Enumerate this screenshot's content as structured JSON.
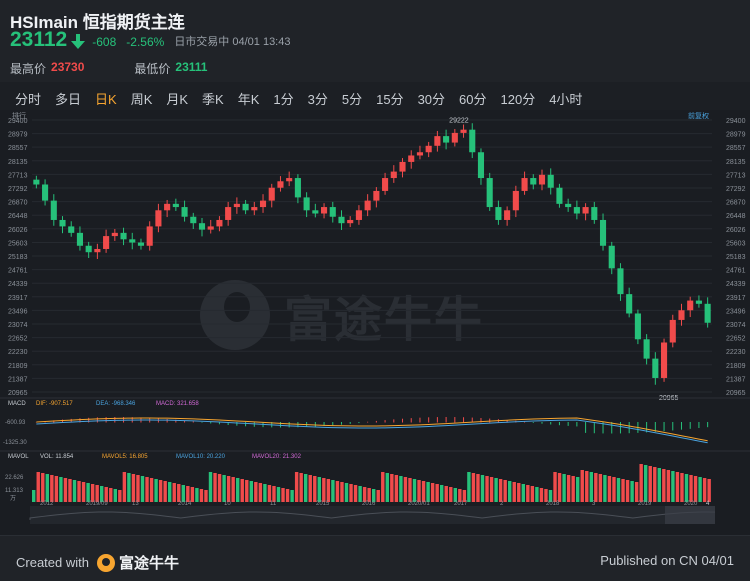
{
  "header": {
    "title": "HSImain 恒指期货主连",
    "last_price": "23112",
    "change": "-608",
    "change_pct": "-2.56%",
    "market_status": "日市交易中  04/01 13:43",
    "high_label": "最高价",
    "high_value": "23730",
    "low_label": "最低价",
    "low_value": "23111"
  },
  "tabs": [
    "分时",
    "多日",
    "日K",
    "周K",
    "月K",
    "季K",
    "年K",
    "1分",
    "3分",
    "5分",
    "15分",
    "30分",
    "60分",
    "120分",
    "4小时"
  ],
  "active_tab": "日K",
  "chart": {
    "right_label": "前复权",
    "price_tag": "排行",
    "high_marker": "29222",
    "low_marker": "20965",
    "macd_labels": {
      "name": "MACD",
      "dif": "DIF: -907.517",
      "dea": "DEA: -968.346",
      "macd": "MACD: 321.658"
    },
    "vol_labels": {
      "name": "MAVOL",
      "vol": "VOL: 11.854",
      "mavol5": "MAVOL5: 16.805",
      "mavol10": "MAVOL10: 20.220",
      "mavol20": "MAVOL20: 21.302"
    },
    "vol_axis": [
      "22.626",
      "11.313",
      "万"
    ],
    "macd_axis": [
      "-600.93",
      "-1325.30"
    ],
    "years": [
      "2012",
      "2019/09",
      "13",
      "2014",
      "10",
      "11",
      "2015",
      "2016",
      "2020/01",
      "2017",
      "2",
      "2018",
      "3",
      "2019",
      "2020"
    ],
    "scroll_end": "4"
  },
  "chart_data": {
    "type": "candlestick",
    "y_ticks_left": [
      "29400",
      "28979",
      "28557",
      "28135",
      "27713",
      "27292",
      "26870",
      "26448",
      "26026",
      "25603",
      "25183",
      "24761",
      "24339",
      "23917",
      "23496",
      "23074",
      "22652",
      "22230",
      "21809",
      "21387",
      "20965"
    ],
    "y_ticks_right": [
      "29400",
      "28979",
      "28557",
      "28135",
      "27713",
      "27292",
      "26870",
      "26448",
      "26026",
      "25603",
      "25183",
      "24761",
      "24339",
      "23917",
      "23496",
      "23074",
      "22652",
      "22230",
      "21809",
      "21387",
      "20965"
    ],
    "ylim": [
      20965,
      29400
    ],
    "x_labels": [
      "2019/09",
      "10",
      "11",
      "2020/01",
      "2",
      "3",
      "4"
    ],
    "closes": [
      27400,
      26900,
      26300,
      26100,
      25900,
      25500,
      25300,
      25400,
      25800,
      25900,
      25700,
      25600,
      25500,
      26100,
      26600,
      26800,
      26700,
      26400,
      26200,
      26000,
      26100,
      26300,
      26700,
      26800,
      26600,
      26700,
      26900,
      27300,
      27500,
      27600,
      27000,
      26600,
      26500,
      26700,
      26400,
      26200,
      26300,
      26600,
      26900,
      27200,
      27600,
      27800,
      28100,
      28300,
      28400,
      28600,
      28900,
      28700,
      29000,
      29100,
      28400,
      27600,
      26700,
      26300,
      26600,
      27200,
      27600,
      27400,
      27700,
      27300,
      26800,
      26700,
      26500,
      26700,
      26300,
      25500,
      24800,
      24000,
      23400,
      22600,
      22000,
      21400,
      22500,
      23200,
      23500,
      23800,
      23700,
      23112
    ]
  },
  "footer": {
    "created_with": "Created with",
    "brand": "富途牛牛",
    "published": "Published on CN 04/01"
  },
  "watermark": "富途牛牛",
  "colors": {
    "up": "#f04b4b",
    "down": "#26c17a",
    "accent": "#f7a530"
  }
}
